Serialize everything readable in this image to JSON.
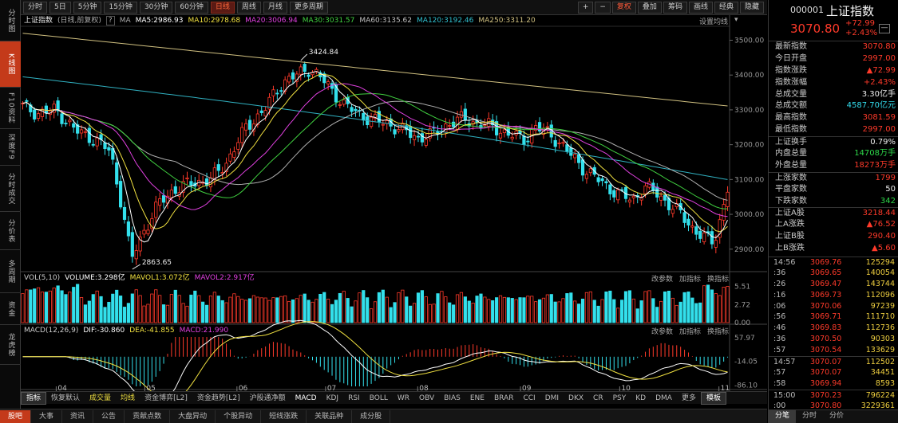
{
  "periods": [
    "分时",
    "5日",
    "5分钟",
    "15分钟",
    "30分钟",
    "60分钟",
    "日线",
    "周线",
    "月线",
    "更多周期"
  ],
  "toolbar_right": {
    "plus": "+",
    "minus": "−",
    "fq": "复权",
    "overlay": "叠加",
    "chip": "筹码",
    "draw": "画线",
    "classic": "经典",
    "hide": "隐藏"
  },
  "left_tabs": [
    "分时图",
    "K线图",
    "F10资料",
    "深度F9",
    "分时成交",
    "分价表",
    "多周期",
    "资金",
    "龙虎榜"
  ],
  "kline_info": {
    "title": "上证指数",
    "type": "(日线,前复权)",
    "help": "?",
    "ma": "MA",
    "ma5": "MA5:2986.93",
    "ma10": "MA10:2978.68",
    "ma20": "MA20:3006.94",
    "ma30": "MA30:3031.57",
    "ma60": "MA60:3135.62",
    "ma120": "MA120:3192.46",
    "ma250": "MA250:3311.20",
    "setting": "设置均线"
  },
  "price_axis": [
    "3500.00",
    "3400.00",
    "3300.00",
    "3200.00",
    "3100.00",
    "3000.00",
    "2900.00"
  ],
  "annotations": {
    "high": "3424.84",
    "low": "2863.65"
  },
  "vol_info": {
    "name": "VOL(5,10)",
    "volume": "VOLUME:3.298亿",
    "mavol1": "MAVOL1:3.072亿",
    "mavol2": "MAVOL2:2.917亿"
  },
  "vol_axis": [
    "5.51",
    "2.72",
    "0.00"
  ],
  "macd_info": {
    "name": "MACD(12,26,9)",
    "dif": "DIF:-30.860",
    "dea": "DEA:-41.855",
    "macd": "MACD:21.990"
  },
  "macd_axis": [
    "57.97",
    "-14.05",
    "-86.10"
  ],
  "panel_ops": {
    "params": "改参数",
    "add": "加指标",
    "switch": "换指标"
  },
  "months": [
    "04",
    "05",
    "06",
    "07",
    "08",
    "09",
    "10",
    "11"
  ],
  "indicator_tabs": [
    "指标",
    "恢复默认",
    "成交量",
    "均线",
    "资金博弈[L2]",
    "资金趋势[L2]",
    "沪股通净额",
    "MACD",
    "KDJ",
    "RSI",
    "BOLL",
    "WR",
    "OBV",
    "BIAS",
    "ENE",
    "BRAR",
    "CCI",
    "DMI",
    "DKX",
    "CR",
    "PSY",
    "KD",
    "DMA",
    "更多",
    "模板"
  ],
  "footer_tabs": [
    "股吧",
    "大事",
    "资讯",
    "公告",
    "贡献点数",
    "大盘异动",
    "个股异动",
    "短线涨跌",
    "关联品种",
    "成分股"
  ],
  "stock": {
    "code": "000001",
    "name": "上证指数",
    "price": "3070.80",
    "change": "+72.99",
    "pct": "+2.43%",
    "menu": "—"
  },
  "stats1": [
    {
      "k": "最新指数",
      "v": "3070.80",
      "c": "red"
    },
    {
      "k": "今日开盘",
      "v": "2997.00",
      "c": "red"
    },
    {
      "k": "指数涨跌",
      "v": "▲72.99",
      "c": "red"
    },
    {
      "k": "指数涨幅",
      "v": "+2.43%",
      "c": "red"
    },
    {
      "k": "总成交量",
      "v": "3.30亿手",
      "c": "white"
    },
    {
      "k": "总成交额",
      "v": "4587.70亿元",
      "c": "cyan"
    },
    {
      "k": "最高指数",
      "v": "3081.59",
      "c": "red"
    },
    {
      "k": "最低指数",
      "v": "2997.00",
      "c": "red"
    }
  ],
  "stats2": [
    {
      "k": "上证换手",
      "v": "0.79%",
      "c": "white"
    },
    {
      "k": "内盘总量",
      "v": "14708万手",
      "c": "green"
    },
    {
      "k": "外盘总量",
      "v": "18273万手",
      "c": "red"
    }
  ],
  "stats3": [
    {
      "k": "上涨家数",
      "v": "1799",
      "c": "red"
    },
    {
      "k": "平盘家数",
      "v": "50",
      "c": "white"
    },
    {
      "k": "下跌家数",
      "v": "342",
      "c": "green"
    }
  ],
  "stats4": [
    {
      "k": "上证A股",
      "v": "3218.44",
      "c": "red"
    },
    {
      "k": "上A涨跌",
      "v": "▲76.52",
      "c": "red"
    },
    {
      "k": "上证B股",
      "v": "290.40",
      "c": "red"
    },
    {
      "k": "上B涨跌",
      "v": "▲5.60",
      "c": "red"
    }
  ],
  "ticks1": [
    {
      "t": "14:56",
      "p": "3069.76",
      "v": "125294"
    },
    {
      "t": ":36",
      "p": "3069.65",
      "v": "140054"
    },
    {
      "t": ":26",
      "p": "3069.47",
      "v": "143744"
    },
    {
      "t": ":16",
      "p": "3069.73",
      "v": "112096"
    },
    {
      "t": ":06",
      "p": "3070.06",
      "v": "97239"
    },
    {
      "t": ":56",
      "p": "3069.71",
      "v": "111710"
    },
    {
      "t": ":46",
      "p": "3069.83",
      "v": "112736"
    },
    {
      "t": ":36",
      "p": "3070.50",
      "v": "90303"
    },
    {
      "t": ":57",
      "p": "3070.54",
      "v": "133629"
    }
  ],
  "ticks2": [
    {
      "t": "14:57",
      "p": "3070.07",
      "v": "112502"
    },
    {
      "t": ":57",
      "p": "3070.07",
      "v": "34451"
    },
    {
      "t": ":58",
      "p": "3069.94",
      "v": "8593"
    }
  ],
  "ticks3": [
    {
      "t": "15:00",
      "p": "3070.23",
      "v": "796224"
    },
    {
      "t": ":00",
      "p": "3070.80",
      "v": "3229361"
    }
  ],
  "right_footer": [
    "分笔",
    "分时",
    "分价"
  ],
  "colors": {
    "up": "#ff3a2a",
    "down": "#33e0ec",
    "ma5": "#ffffff",
    "ma10": "#f0e040",
    "ma20": "#e040e0",
    "ma30": "#40d040",
    "ma60": "#b0b0b0",
    "ma120": "#30b0c0",
    "ma250": "#d0c080"
  }
}
